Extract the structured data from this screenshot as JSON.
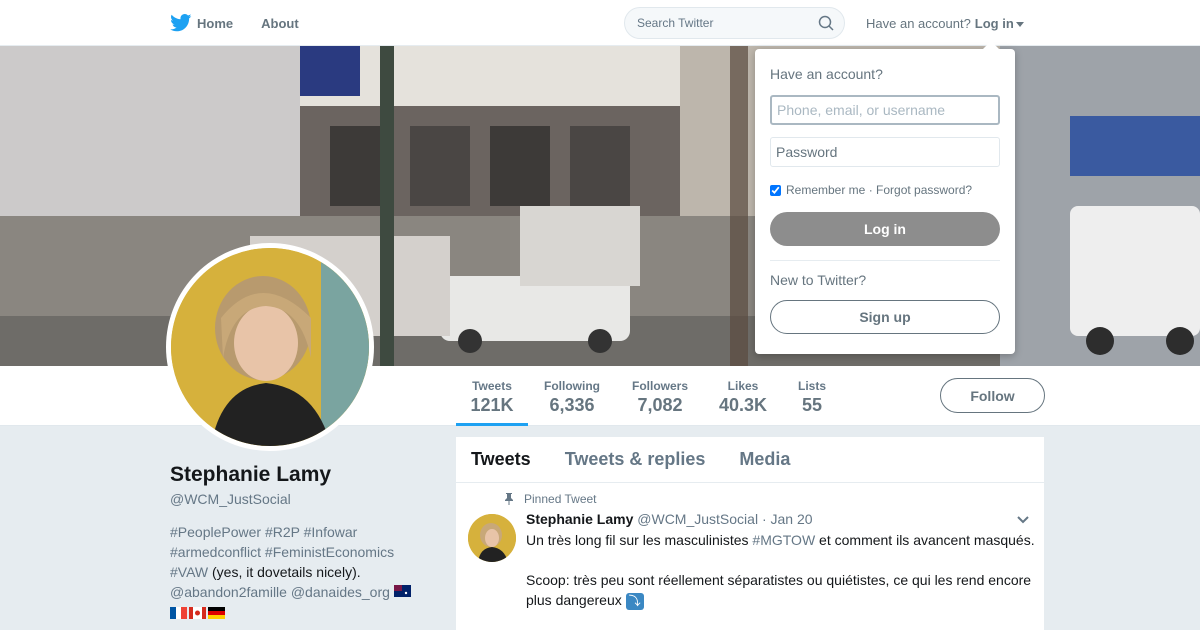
{
  "nav": {
    "home_label": "Home",
    "about_label": "About",
    "search_placeholder": "Search Twitter",
    "account_prompt": "Have an account?",
    "login_label": "Log in"
  },
  "profile": {
    "name": "Stephanie Lamy",
    "handle": "@WCM_JustSocial",
    "bio": {
      "tags_line1": "#PeoplePower #R2P #Infowar",
      "tags_line2": "#armedconflict #FeministEconomics",
      "tag_vaw": "#VAW",
      "bio_text": " (yes, it dovetails nicely).",
      "mentions": "@abandon2famille @danaides_org"
    }
  },
  "stats": [
    {
      "label": "Tweets",
      "value": "121K"
    },
    {
      "label": "Following",
      "value": "6,336"
    },
    {
      "label": "Followers",
      "value": "7,082"
    },
    {
      "label": "Likes",
      "value": "40.3K"
    },
    {
      "label": "Lists",
      "value": "55"
    }
  ],
  "follow_label": "Follow",
  "timeline": {
    "tabs": [
      "Tweets",
      "Tweets & replies",
      "Media"
    ],
    "pinned_label": "Pinned Tweet",
    "tweet": {
      "author": "Stephanie Lamy",
      "handle": "@WCM_JustSocial",
      "date": "· Jan 20",
      "text_before": "Un très long fil sur les masculinistes ",
      "hashtag": "#MGTOW",
      "text_after": " et comment ils avancent masqués.",
      "text_scoop": "Scoop: très peu sont réellement séparatistes ou quiétistes, ce qui les rend encore plus dangereux ",
      "emoji": "⤵"
    }
  },
  "login_dropdown": {
    "title": "Have an account?",
    "username_placeholder": "Phone, email, or username",
    "password_placeholder": "Password",
    "remember_label": "Remember me · Forgot password?",
    "login_button": "Log in",
    "new_prompt": "New to Twitter?",
    "signup_button": "Sign up"
  },
  "colors": {
    "brand": "#1da1f2",
    "muted": "#657786",
    "header_bg": "#b8b0a6"
  }
}
